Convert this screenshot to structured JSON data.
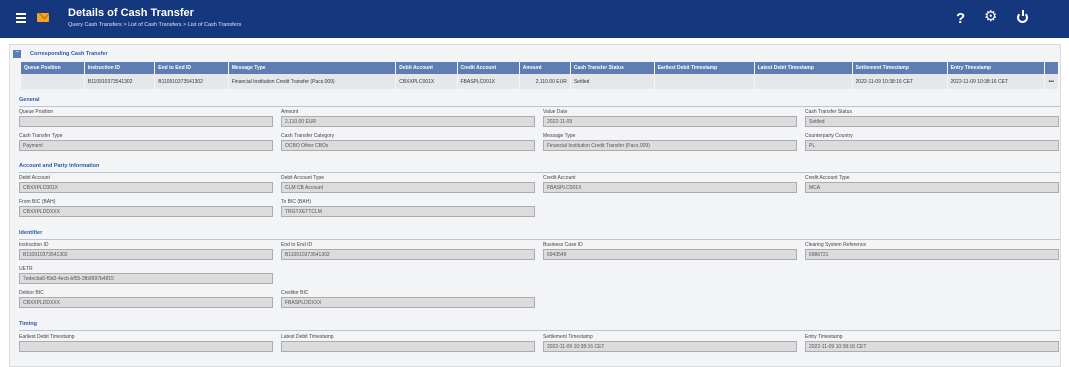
{
  "header": {
    "title": "Details of Cash Transfer",
    "breadcrumb": "Query Cash Transfers > List of Cash Transfers > List of Cash Transfers",
    "help_label": "?",
    "icons": [
      "menu-icon",
      "envelope-icon",
      "help-icon",
      "gear-icon",
      "power-icon"
    ]
  },
  "corresponding": {
    "title": "Corresponding Cash Transfer",
    "collapse_label": "−",
    "columns": [
      "Queue Position",
      "Instruction ID",
      "End to End ID",
      "Message Type",
      "Debit Account",
      "Credit Account",
      "Amount",
      "Cash Transfer Status",
      "Earliest Debit Timestamp",
      "Latest Debit Timestamp",
      "Settlement Timestamp",
      "Entry Timestamp",
      ""
    ],
    "rows": [
      [
        "",
        "B110910373541302",
        "B110910373541302",
        "Financial Institution Credit Transfer (Pacs.009)",
        "CBXXPLC001X",
        "FBASPLC001X",
        "2,110.00 EUR",
        "Settled",
        "",
        "",
        "2022-11-09 10:38:16 CET",
        "2022-11-09 10:38:16 CET",
        "•••"
      ]
    ]
  },
  "sections": {
    "general": {
      "title": "General",
      "fields": [
        {
          "label": "Queue Position",
          "value": ""
        },
        {
          "label": "Amount",
          "value": "2,110.00 EUR"
        },
        {
          "label": "Value Date",
          "value": "2022-11-09"
        },
        {
          "label": "Cash Transfer Status",
          "value": "Settled"
        },
        {
          "label": "Cash Transfer Type",
          "value": "Payment"
        },
        {
          "label": "Cash Transfer Category",
          "value": "OCBO Other CBOs"
        },
        {
          "label": "Message Type",
          "value": "Financial Institution Credit Transfer (Pacs.009)"
        },
        {
          "label": "Counterparty Country",
          "value": "PL"
        }
      ]
    },
    "account": {
      "title": "Account and Party Information",
      "fields": [
        {
          "label": "Debit Account",
          "value": "CBXXPLC001X"
        },
        {
          "label": "Debit Account Type",
          "value": "CLM CB Account"
        },
        {
          "label": "Credit Account",
          "value": "FBASPLC001X"
        },
        {
          "label": "Credit Account Type",
          "value": "MCA"
        },
        {
          "label": "From BIC (BAH)",
          "value": "CBXXPLDDXXX"
        },
        {
          "label": "To BIC (BAH)",
          "value": "TRGTXETTCLM"
        }
      ]
    },
    "identifier": {
      "title": "Identifier",
      "fields": [
        {
          "label": "Instruction ID",
          "value": "B110910373541302"
        },
        {
          "label": "End to End ID",
          "value": "B110910373541302"
        },
        {
          "label": "Business Case ID",
          "value": "6943549"
        },
        {
          "label": "Clearing System Reference",
          "value": "6986721"
        },
        {
          "label": "UETR",
          "value": "7edecba0-f0d2-4ecb-bf55-3fb9997b4815"
        },
        {
          "label": "Debtor BIC",
          "value": "CBXXPLDDXXX"
        },
        {
          "label": "Creditor BIC",
          "value": "FBASPLDDXXX"
        }
      ]
    },
    "timing": {
      "title": "Timing",
      "fields": [
        {
          "label": "Earliest Debit Timestamp",
          "value": ""
        },
        {
          "label": "Latest Debit Timestamp",
          "value": ""
        },
        {
          "label": "Settlement Timestamp",
          "value": "2022-11-09 10:38:16 CET"
        },
        {
          "label": "Entry Timestamp",
          "value": "2022-11-09 10:38:16 CET"
        }
      ]
    }
  },
  "colors": {
    "header_bg": "#14377d",
    "table_header_bg": "#5d7db3",
    "section_title": "#2e5aa0",
    "envelope": "#f5a623"
  }
}
